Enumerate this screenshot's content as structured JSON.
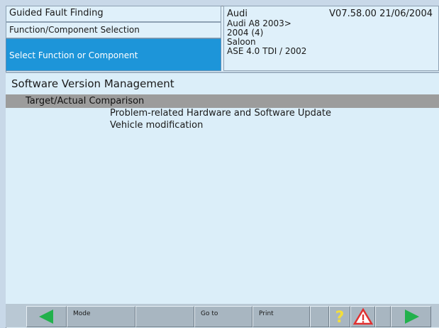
{
  "header": {
    "left": {
      "row1": "Guided Fault Finding",
      "row2": "Function/Component Selection",
      "row3": "Select Function or Component"
    },
    "right": {
      "make": "Audi",
      "version": "V07.58.00 21/06/2004",
      "model": "Audi A8 2003>",
      "year": "2004 (4)",
      "body": "Saloon",
      "engine": "ASE 4.0 TDI / 2002"
    }
  },
  "main": {
    "title": "Software Version Management",
    "selected_item": "Target/Actual Comparison",
    "items": [
      "Problem-related Hardware and Software Update",
      "Vehicle modification"
    ]
  },
  "toolbar": {
    "mode_label": "Mode",
    "goto_label": "Go to",
    "print_label": "Print",
    "icons": {
      "back": "arrow-left-icon",
      "help": "question-mark-icon",
      "warning": "warning-triangle-icon",
      "forward": "arrow-right-icon"
    }
  },
  "colors": {
    "selected_blue": "#1d95d9",
    "panel_bg": "#dbeef9",
    "highlight_gray": "#9c9c9c",
    "arrow_green": "#22b14c",
    "help_yellow": "#f3de3a",
    "warning_red": "#e03030"
  }
}
